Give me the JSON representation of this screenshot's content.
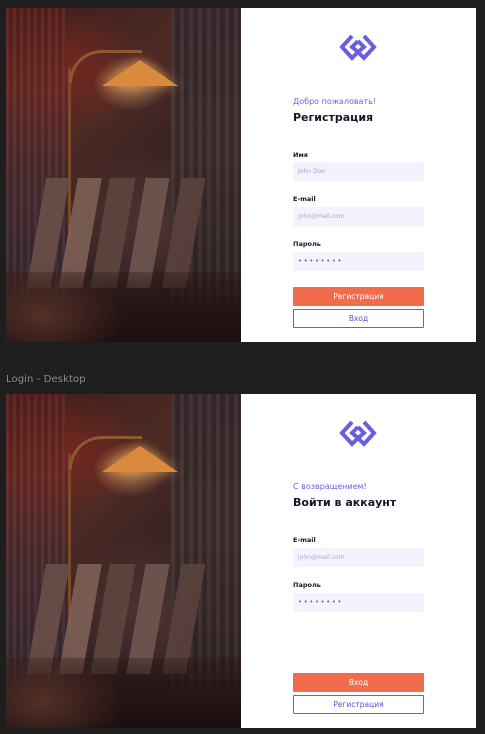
{
  "canvas": {
    "background": "#1e1e1e"
  },
  "colors": {
    "accent": "#6a5ee0",
    "primary_button": "#f26b4a",
    "input_bg": "#f4f3fd",
    "panel_bg": "#ffffff"
  },
  "frames": {
    "second_frame_label": "Login - Desktop"
  },
  "registration": {
    "logo_icon": "infinity-link-icon",
    "greeting": "Добро пожаловать!",
    "title": "Регистрация",
    "name_label": "Имя",
    "name_placeholder": "John Doe",
    "email_label": "E-mail",
    "email_placeholder": "john@mail.com",
    "password_label": "Пароль",
    "password_value": "••••••••",
    "primary_button": "Регистрация",
    "secondary_button": "Вход"
  },
  "login": {
    "logo_icon": "infinity-link-icon",
    "greeting": "С возвращением!",
    "title": "Войти в аккаунт",
    "email_label": "E-mail",
    "email_placeholder": "john@mail.com",
    "password_label": "Пароль",
    "password_value": "••••••••",
    "primary_button": "Вход",
    "secondary_button": "Регистрация"
  }
}
